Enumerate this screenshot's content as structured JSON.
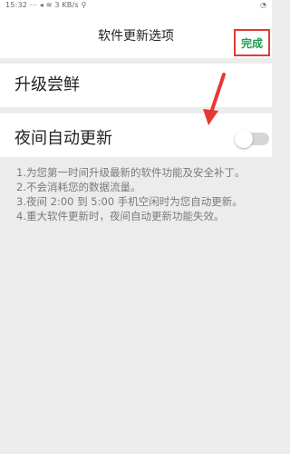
{
  "status_bar": {
    "left_text": "15:32 ⋯ ◂ ≋ 3 KB/s ⚲",
    "right_text": "◔"
  },
  "header": {
    "title": "软件更新选项",
    "done_label": "完成"
  },
  "options": {
    "upgrade_label": "升级尝鲜",
    "night_update_label": "夜间自动更新"
  },
  "notes": [
    "1.为您第一时间升级最新的软件功能及安全补丁。",
    "2.不会消耗您的数据流量。",
    "3.夜间 2:00 到 5:00 手机空闲时为您自动更新。",
    "4.重大软件更新时，夜间自动更新功能失效。"
  ],
  "colors": {
    "done_text": "#1aa14a",
    "highlight_border": "#e53935",
    "arrow": "#e53935",
    "toggle_track_off": "#d6d6d6"
  },
  "toggle_state": "off"
}
